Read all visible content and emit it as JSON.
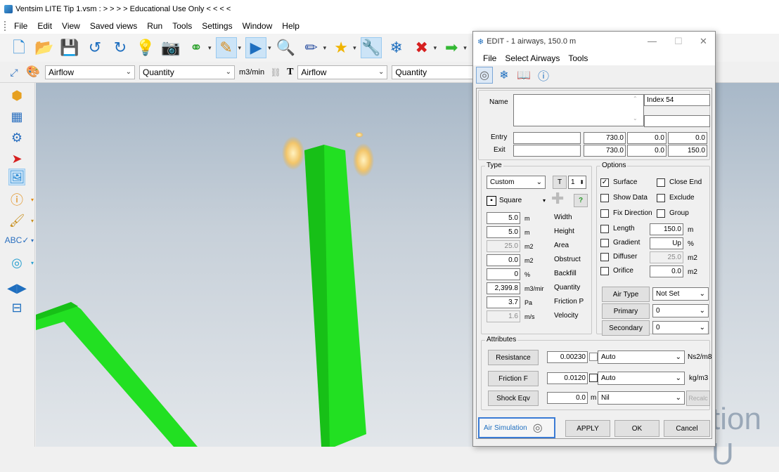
{
  "app": {
    "title": "Ventsim LITE  Tip 1.vsm   : > > > > Educational Use Only < < < <",
    "menu": [
      "File",
      "Edit",
      "View",
      "Saved views",
      "Run",
      "Tools",
      "Settings",
      "Window",
      "Help"
    ]
  },
  "toolbar2": {
    "color_mode": "Airflow",
    "color_value": "Quantity",
    "units": "m3/min",
    "text_label": "T",
    "text_mode": "Airflow",
    "text_value": "Quantity"
  },
  "watermark": "tion U",
  "dialog": {
    "title": "EDIT - 1 airways, 150.0 m",
    "menu": [
      "File",
      "Select Airways",
      "Tools"
    ],
    "name_label": "Name",
    "index": "Index 54",
    "entry_label": "Entry",
    "exit_label": "Exit",
    "entry": {
      "x": "730.0",
      "y": "0.0",
      "z": "0.0"
    },
    "exit": {
      "x": "730.0",
      "y": "0.0",
      "z": "150.0"
    },
    "type_section": "Type",
    "type_value": "Custom",
    "t_button": "T",
    "t_spin": "1",
    "shape_value": "Square",
    "help_btn": "?",
    "rows": [
      {
        "value": "5.0",
        "unit": "m",
        "label": "Width"
      },
      {
        "value": "5.0",
        "unit": "m",
        "label": "Height"
      },
      {
        "value": "25.0",
        "unit": "m2",
        "label": "Area"
      },
      {
        "value": "0.0",
        "unit": "m2",
        "label": "Obstruct"
      },
      {
        "value": "0",
        "unit": "%",
        "label": "Backfill"
      },
      {
        "value": "2,399.8",
        "unit": "m3/mir",
        "label": "Quantity"
      },
      {
        "value": "3.7",
        "unit": "Pa",
        "label": "Friction P"
      },
      {
        "value": "1.6",
        "unit": "m/s",
        "label": "Velocity"
      }
    ],
    "options_section": "Options",
    "options": {
      "surface": "Surface",
      "close_end": "Close End",
      "show_data": "Show Data",
      "exclude": "Exclude",
      "fix_direction": "Fix Direction",
      "group": "Group",
      "length": "Length",
      "length_value": "150.0",
      "length_unit": "m",
      "gradient": "Gradient",
      "gradient_value": "Up",
      "gradient_unit": "%",
      "diffuser": "Diffuser",
      "diffuser_value": "25.0",
      "diffuser_unit": "m2",
      "orifice": "Orifice",
      "orifice_value": "0.0",
      "orifice_unit": "m2",
      "surface_checked": true
    },
    "air_type_btn": "Air Type",
    "air_type_value": "Not Set",
    "primary_btn": "Primary",
    "primary_value": "0",
    "secondary_btn": "Secondary",
    "secondary_value": "0",
    "attributes_section": "Attributes",
    "resistance_btn": "Resistance",
    "resistance_value": "0.00230",
    "resistance_mode": "Auto",
    "resistance_unit": "Ns2/m8",
    "friction_btn": "Friction F",
    "friction_value": "0.0120",
    "friction_mode": "Auto",
    "friction_unit": "kg/m3",
    "shock_btn": "Shock Eqv",
    "shock_value": "0.0",
    "shock_unit": "m",
    "shock_mode": "Nil",
    "recalc_btn": "Recalc",
    "air_sim_btn": "Air Simulation",
    "apply_btn": "APPLY",
    "ok_btn": "OK",
    "cancel_btn": "Cancel"
  },
  "colors": {
    "airway": "#22e022",
    "accent": "#1f6fbf"
  }
}
